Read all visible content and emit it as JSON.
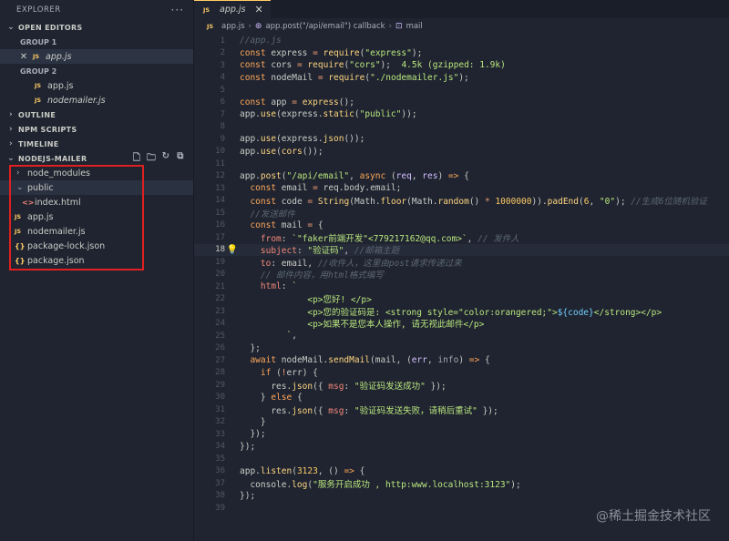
{
  "sidebar": {
    "title": "EXPLORER",
    "more": "···",
    "open_editors": "OPEN EDITORS",
    "group1": "GROUP 1",
    "group1_file": "app.js",
    "group2": "GROUP 2",
    "group2_files": [
      "app.js",
      "nodemailer.js"
    ],
    "outline": "OUTLINE",
    "npm_scripts": "NPM SCRIPTS",
    "timeline": "TIMELINE",
    "project": "NODEJS-MAILER",
    "tree": {
      "node_modules": "node_modules",
      "public": "public",
      "index_html": "index.html",
      "app_js": "app.js",
      "nodemailer_js": "nodemailer.js",
      "package_lock": "package-lock.json",
      "package_json": "package.json"
    },
    "js_badge": "JS",
    "json_badge": "{}",
    "html_badge": "<>"
  },
  "editor": {
    "tab": "app.js",
    "breadcrumb": [
      "app.js",
      "app.post(\"/api/email\") callback",
      "mail"
    ],
    "current_line": 18
  },
  "watermark": "@稀土掘金技术社区"
}
